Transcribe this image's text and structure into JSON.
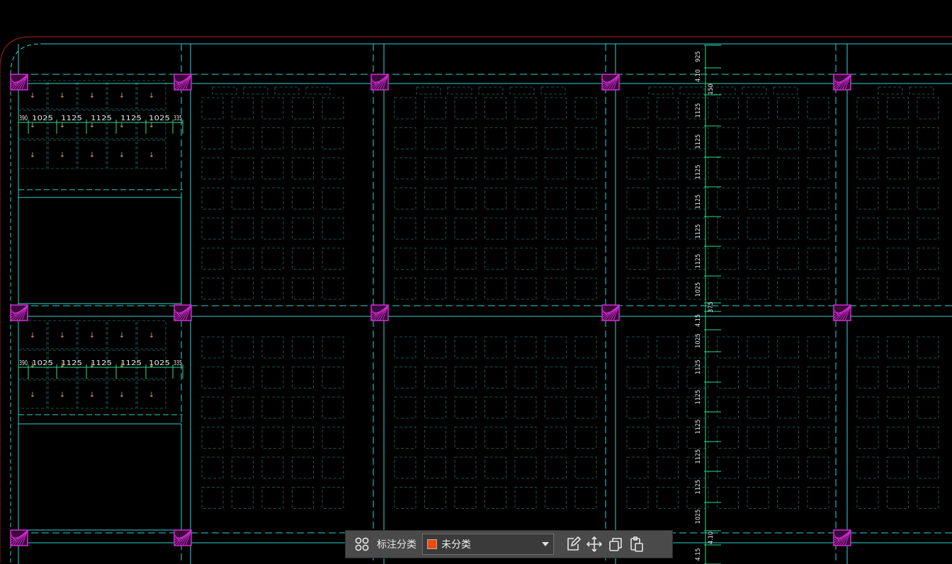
{
  "colors": {
    "background": "#000000",
    "boundary": "#8b1c1c",
    "cyan": "#2fd4d4",
    "grid": "#1f6e66",
    "column": "#d42ad4",
    "dimension": "#2ddc8a",
    "arrow": "#c8a050",
    "category_swatch": "#f04a0c"
  },
  "dimensions": {
    "top_row": [
      "390",
      "1025",
      "1125",
      "1125",
      "1125",
      "1025",
      "335"
    ],
    "lower_row": [
      "390",
      "1025",
      "1125",
      "1125",
      "1125",
      "1025",
      "335"
    ],
    "vertical": [
      "925",
      "4.10",
      "150",
      "1125",
      "1125",
      "1125",
      "1125",
      "1125",
      "1125",
      "1025",
      "375",
      "4.15",
      "1025",
      "1125",
      "1125",
      "1125",
      "1125",
      "1125",
      "1025",
      "4.10",
      "4.15"
    ]
  },
  "toolbar": {
    "group_icon": "group-icon",
    "category_label": "标注分类",
    "category_value": "未分类",
    "edit_icon": "edit-icon",
    "move_icon": "move-icon",
    "copy_icon": "copy-icon",
    "paste_icon": "paste-icon"
  }
}
